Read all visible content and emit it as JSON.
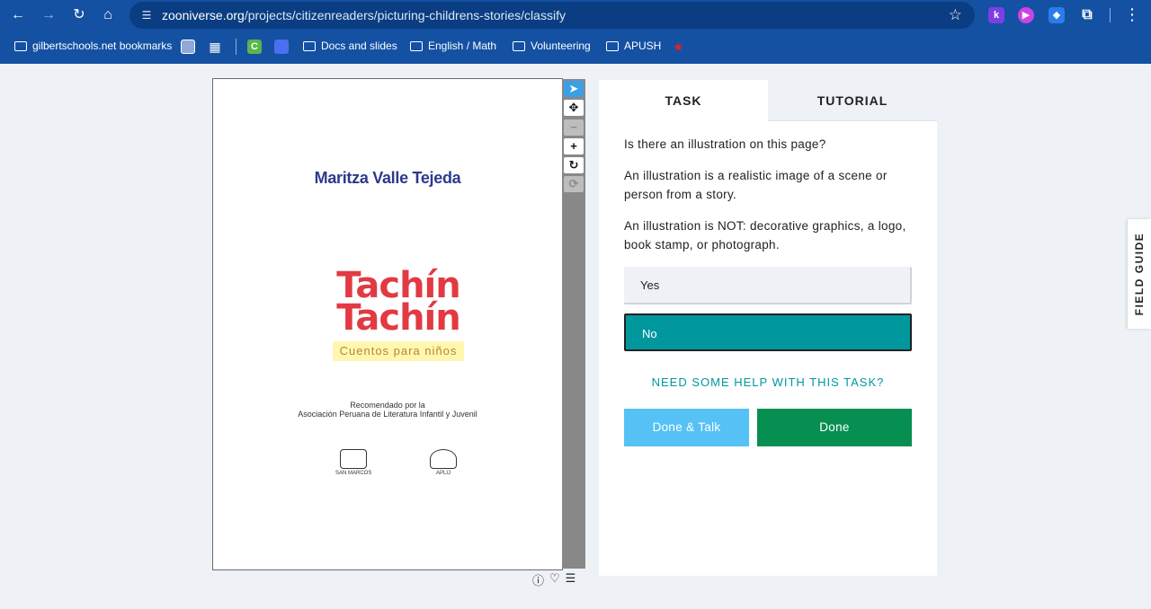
{
  "browser": {
    "url_host": "zooniverse.org",
    "url_path": "/projects/citizenreaders/picturing-childrens-stories/classify",
    "extensions": [
      "k"
    ]
  },
  "bookmarks": {
    "items": [
      "gilbertschools.net bookmarks",
      "Docs and slides",
      "English / Math",
      "Volunteering",
      "APUSH"
    ]
  },
  "subject": {
    "author": "Maritza Valle Tejeda",
    "title_line1": "Tachín",
    "title_line2": "Tachín",
    "subtitle": "Cuentos para niños",
    "recommended_line1": "Recomendado por la",
    "recommended_line2": "Asociación Peruana de Literatura Infantil y Juvenil",
    "seal_a": "SAN MARCOS",
    "seal_b": "APLIJ"
  },
  "task_panel": {
    "tabs": [
      "TASK",
      "TUTORIAL"
    ],
    "question": "Is there an illustration on this page?",
    "help_text_1": "An illustration is a realistic image of a scene or person from a story.",
    "help_text_2": "An illustration is NOT: decorative graphics, a logo, book stamp, or photograph.",
    "answers": [
      "Yes",
      "No"
    ],
    "selected_answer": "No",
    "need_help": "NEED SOME HELP WITH THIS TASK?",
    "done_talk": "Done & Talk",
    "done": "Done"
  },
  "field_guide": "FIELD GUIDE",
  "colors": {
    "accent": "#00979d",
    "done_green": "#078f52",
    "talk_blue": "#56c1f5",
    "chrome_blue": "#1451a3"
  }
}
